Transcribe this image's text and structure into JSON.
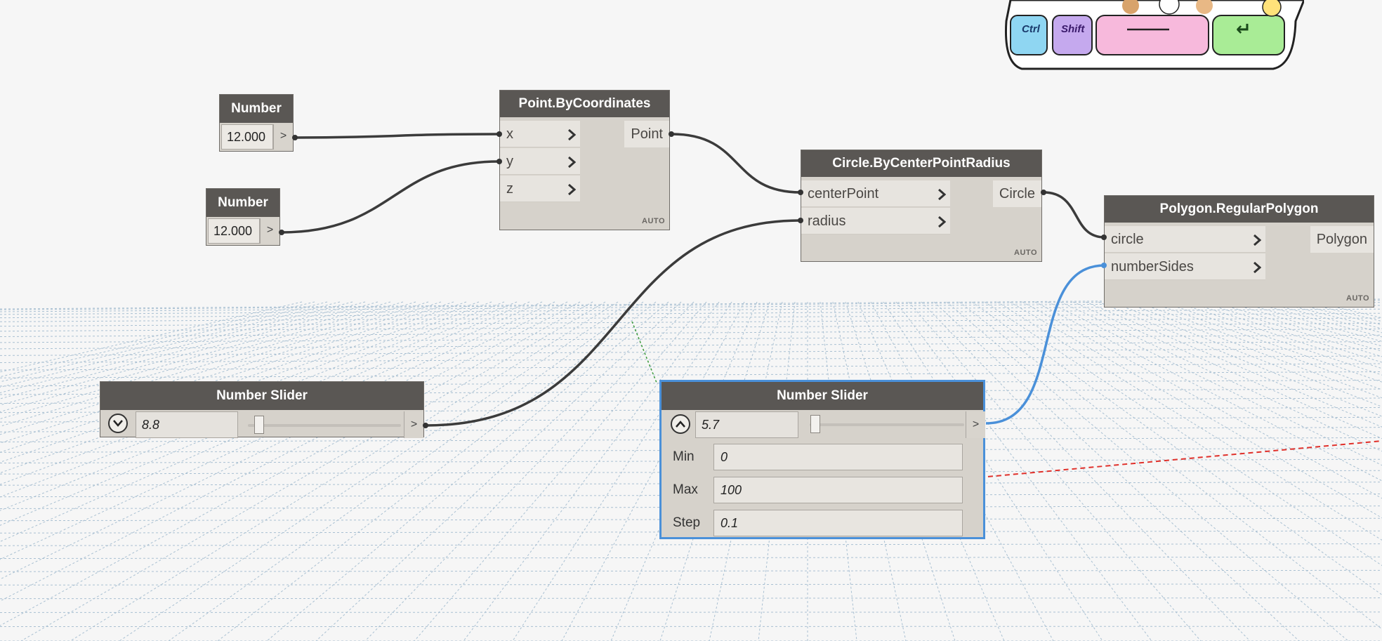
{
  "canvas": {
    "background": "#f6f6f6",
    "grid_color": "#9fb8cc",
    "wire_color": "#3b3b3b",
    "selected_wire_color": "#4a90d9"
  },
  "sticker": {
    "keys": [
      "Ctrl",
      "Shift",
      "",
      "↵"
    ],
    "icon": "keyboard-sticker-image"
  },
  "nodes": {
    "number1": {
      "title": "Number",
      "value": "12.000",
      "out": ">"
    },
    "number2": {
      "title": "Number",
      "value": "12.000",
      "out": ">"
    },
    "point": {
      "title": "Point.ByCoordinates",
      "inputs": [
        "x",
        "y",
        "z"
      ],
      "output": "Point",
      "lacing": "AUTO"
    },
    "circle": {
      "title": "Circle.ByCenterPointRadius",
      "inputs": [
        "centerPoint",
        "radius"
      ],
      "output": "Circle",
      "lacing": "AUTO"
    },
    "polygon": {
      "title": "Polygon.RegularPolygon",
      "inputs": [
        "circle",
        "numberSides"
      ],
      "output": "Polygon",
      "lacing": "AUTO"
    },
    "slider1": {
      "title": "Number Slider",
      "value": "8.8",
      "out": ">",
      "slider_fraction": 0.088
    },
    "slider2": {
      "title": "Number Slider",
      "value": "5.7",
      "out": ">",
      "slider_fraction": 0.057,
      "min_label": "Min",
      "min": "0",
      "max_label": "Max",
      "max": "100",
      "step_label": "Step",
      "step": "0.1"
    }
  }
}
